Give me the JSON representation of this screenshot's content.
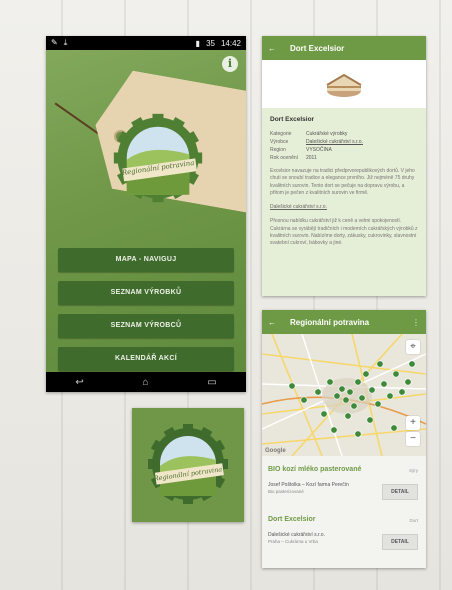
{
  "phone1": {
    "status": {
      "time": "14:42",
      "battery": "35"
    },
    "info_label": "i",
    "seal_text": "Regionální potravina",
    "menu": [
      {
        "label": "MAPA - NAVIGUJ"
      },
      {
        "label": "SEZNAM VÝROBKŮ"
      },
      {
        "label": "SEZNAM VÝROBCŮ"
      },
      {
        "label": "KALENDÁŘ AKCÍ"
      }
    ]
  },
  "detail": {
    "toolbar_title": "Dort Excelsior",
    "product_title": "Dort Excelsior",
    "fields": [
      {
        "key": "Kategorie",
        "value": "Cukrářské výrobky"
      },
      {
        "key": "Výrobce",
        "value": "Dalešické cukrářství s.r.o."
      },
      {
        "key": "Region",
        "value": "VYSOČINA"
      },
      {
        "key": "Rok ocenění",
        "value": "2011"
      }
    ],
    "description": "Excelsior navazuje na tradici předprvorepublikových dortů. V jeho chuti se snoubí tradice a elegance prvního. Již nejméně 75 druhy kvalitních surovin. Tento dort se pečuje na dopravu výrobu, a přitom je pečen z kvalitních surovin ve firmě.",
    "link_text": "Dalešické cukrářství s.r.o.",
    "description2": "Přesnou nabídku cukrářství již k ceně a velmi spokojeností. Cukrárna se vyrábějí tradičních i moderních cukrářských výrobků z kvalitních surovin. Nabízíme dorty, zákusky, cukrovinky, slavnostní svatební cukroví, bábovky a jiné."
  },
  "map_screen": {
    "toolbar_title": "Regionální potravina",
    "map_logo": "Google",
    "cards": [
      {
        "title": "BIO kozí mléko pasterované",
        "tag": "Sýry",
        "line1": "Josef Poštolka – Kozí farma Perečín",
        "line2": "Bio pasterizované",
        "button": "DETAIL"
      },
      {
        "title": "Dort Excelsior",
        "tag": "Dort",
        "line1": "Dalešické cukrářství s.r.o.",
        "line2": "Praha – Cukrárna u Vrba",
        "button": "DETAIL"
      }
    ]
  },
  "tile": {
    "seal_text": "Regionální potravina"
  },
  "colors": {
    "brand_green": "#6f9a45",
    "dark_button": "#3f6b2c",
    "tag_paper": "#e6d4b0"
  }
}
